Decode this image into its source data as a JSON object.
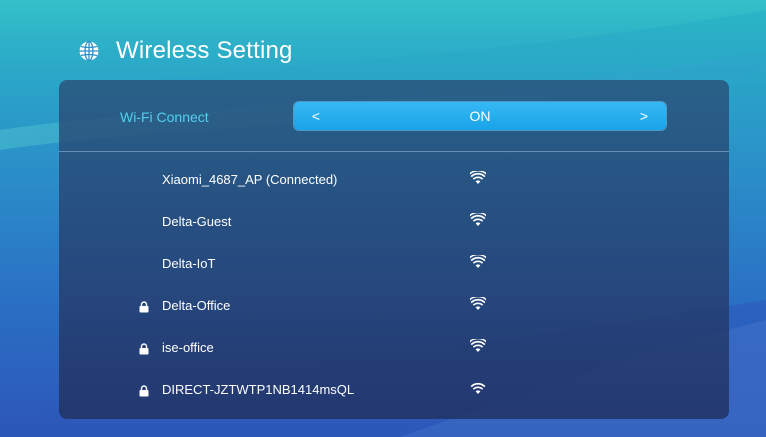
{
  "header": {
    "title": "Wireless Setting",
    "icon": "globe-icon"
  },
  "wifi_connect": {
    "label": "Wi-Fi Connect",
    "value": "ON",
    "prev_symbol": "<",
    "next_symbol": ">"
  },
  "networks": [
    {
      "name": "Xiaomi_4687_AP  (Connected)",
      "locked": false,
      "signal_icon": "wifi-signal-icon"
    },
    {
      "name": "Delta-Guest",
      "locked": false,
      "signal_icon": "wifi-signal-icon"
    },
    {
      "name": "Delta-IoT",
      "locked": false,
      "signal_icon": "wifi-signal-icon"
    },
    {
      "name": "Delta-Office",
      "locked": true,
      "signal_icon": "wifi-signal-icon"
    },
    {
      "name": "ise-office",
      "locked": true,
      "signal_icon": "wifi-signal-icon"
    },
    {
      "name": "DIRECT-JZTWTP1NB1414msQL",
      "locked": true,
      "signal_icon": "wifi-signal-weak-icon"
    }
  ],
  "colors": {
    "accent": "#4fd0ec",
    "selector_bg": "#1aa3e8",
    "text": "#ffffff"
  }
}
